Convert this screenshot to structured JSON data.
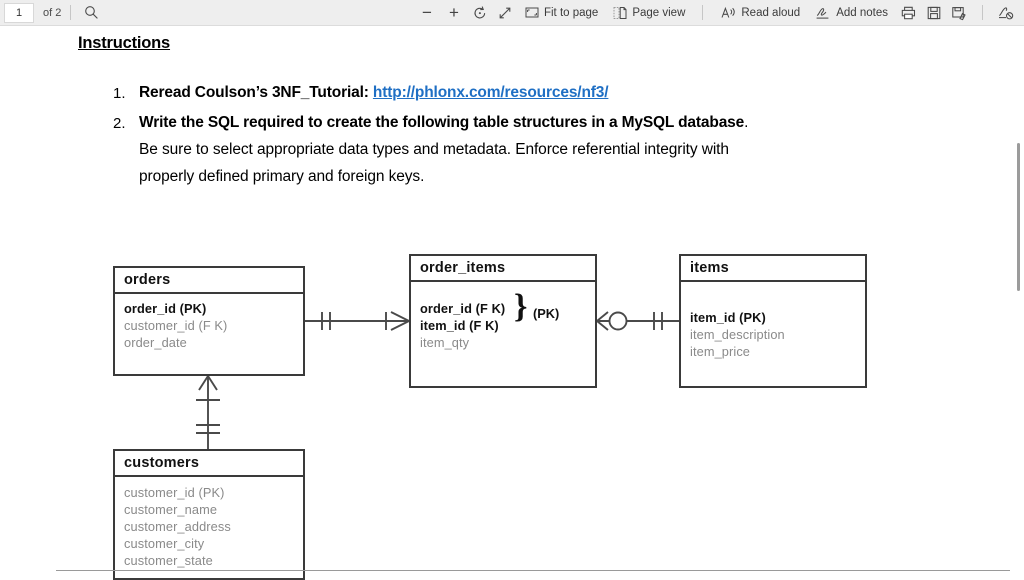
{
  "toolbar": {
    "page_number": "1",
    "page_count_label": "of 2",
    "search_icon": "search-icon",
    "zoom_out_label": "−",
    "zoom_in_label": "+",
    "rotate_icon": "rotate-icon",
    "fit_icon": "fit-to-window-icon",
    "fit_to_page_label": "Fit to page",
    "fit_to_page_icon": "fit-to-page-icon",
    "page_view_label": "Page view",
    "page_view_icon": "page-view-icon",
    "read_aloud_label": "Read aloud",
    "read_aloud_icon": "read-aloud-icon",
    "add_notes_label": "Add notes",
    "add_notes_icon": "add-notes-icon",
    "print_icon": "print-icon",
    "save_icon": "save-icon",
    "save_as_icon": "save-as-icon",
    "erase_ink_icon": "erase-ink-icon"
  },
  "document": {
    "heading": "Instructions",
    "items": [
      {
        "number": "1.",
        "text_before_link": "Reread Coulson’s 3NF_Tutorial: ",
        "link_text": "http://phlonx.com/resources/nf3/"
      },
      {
        "number": "2.",
        "bold_text": "Write the SQL required to create the following table structures in a MySQL database",
        "trailing": ".",
        "line2": "Be sure to select appropriate data types and metadata. Enforce referential integrity with",
        "line3": "properly defined primary and foreign keys."
      }
    ]
  },
  "erd": {
    "entities": [
      {
        "name": "orders",
        "attributes": [
          {
            "text": "order_id (PK)",
            "key": true
          },
          {
            "text": "customer_id (F K)",
            "key": false
          },
          {
            "text": "order_date",
            "key": false
          }
        ]
      },
      {
        "name": "order_items",
        "attributes": [
          {
            "text": "order_id (F K)",
            "key": true
          },
          {
            "text": "item_id (F K)",
            "key": true
          },
          {
            "text": "item_qty",
            "key": false
          }
        ],
        "brace_glyph": "}",
        "brace_label": "(PK)"
      },
      {
        "name": "items",
        "attributes": [
          {
            "text": "item_id (PK)",
            "key": true
          },
          {
            "text": "item_description",
            "key": false
          },
          {
            "text": "item_price",
            "key": false
          }
        ]
      },
      {
        "name": "customers",
        "attributes": [
          {
            "text": "customer_id (PK)",
            "key": false
          },
          {
            "text": "customer_name",
            "key": false
          },
          {
            "text": "customer_address",
            "key": false
          },
          {
            "text": "customer_city",
            "key": false
          },
          {
            "text": "customer_state",
            "key": false
          }
        ]
      }
    ],
    "relationships": [
      {
        "from": "orders",
        "to": "order_items",
        "from_cardinality": "one-and-only-one",
        "to_cardinality": "one-or-many"
      },
      {
        "from": "order_items",
        "to": "items",
        "from_cardinality": "zero-or-many",
        "to_cardinality": "one-and-only-one"
      },
      {
        "from": "orders",
        "to": "customers",
        "from_cardinality": "one-or-many",
        "to_cardinality": "one-and-only-one"
      }
    ]
  },
  "scrollbar": {
    "name": "vertical-scrollbar"
  },
  "colors": {
    "toolbar_bg": "#eeeeee",
    "link": "#1f6fc4",
    "entity_border": "#3a3a3a",
    "attribute_text": "#8a8a8a",
    "key_text": "#111111"
  }
}
